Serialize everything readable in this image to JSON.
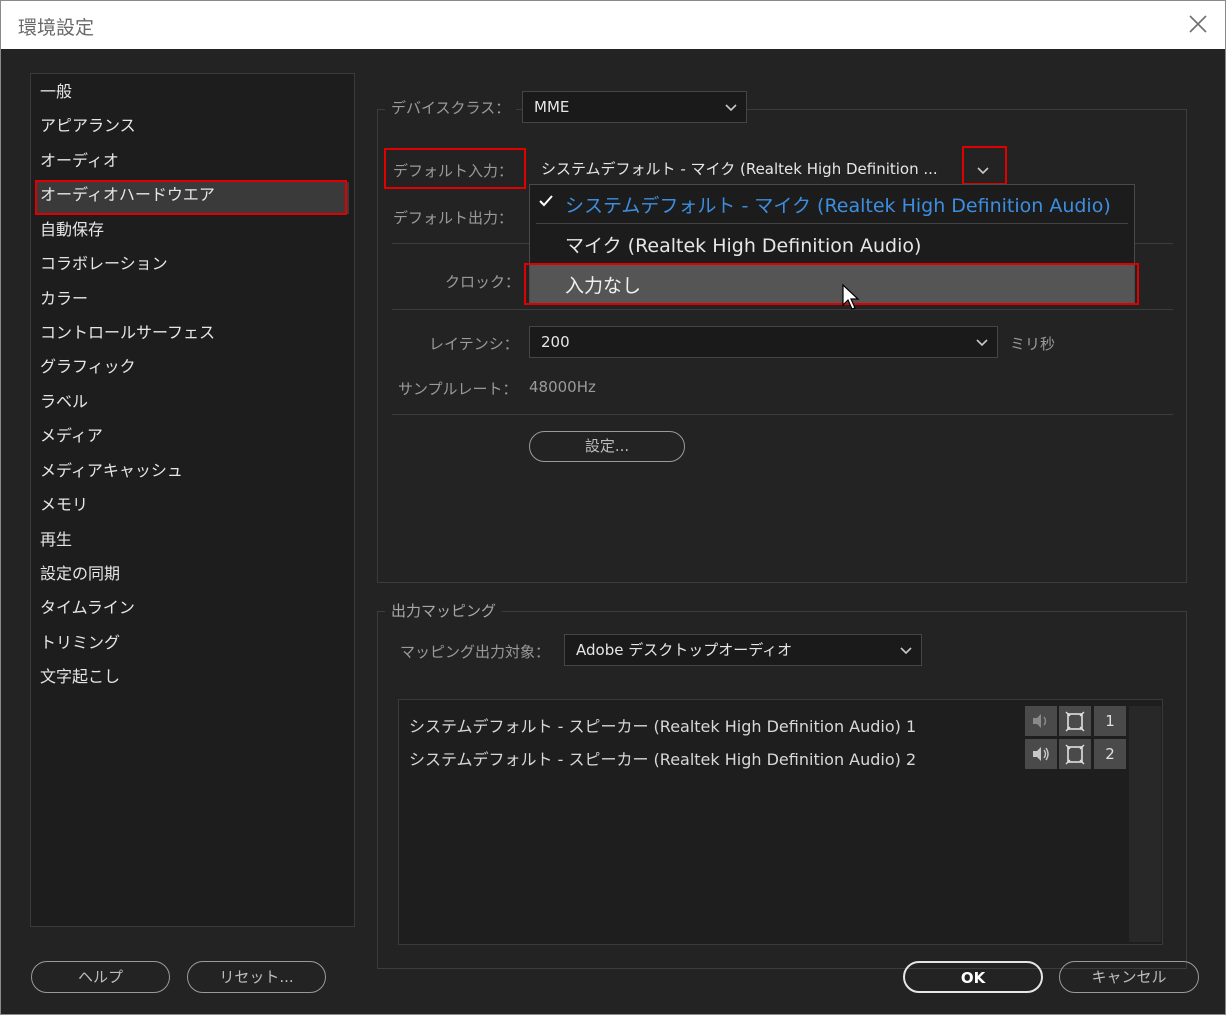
{
  "window": {
    "title": "環境設定"
  },
  "sidebar": {
    "items": [
      {
        "label": "一般"
      },
      {
        "label": "アピアランス"
      },
      {
        "label": "オーディオ"
      },
      {
        "label": "オーディオハードウエア"
      },
      {
        "label": "自動保存"
      },
      {
        "label": "コラボレーション"
      },
      {
        "label": "カラー"
      },
      {
        "label": "コントロールサーフェス"
      },
      {
        "label": "グラフィック"
      },
      {
        "label": "ラベル"
      },
      {
        "label": "メディア"
      },
      {
        "label": "メディアキャッシュ"
      },
      {
        "label": "メモリ"
      },
      {
        "label": "再生"
      },
      {
        "label": "設定の同期"
      },
      {
        "label": "タイムライン"
      },
      {
        "label": "トリミング"
      },
      {
        "label": "文字起こし"
      }
    ],
    "selected": "オーディオハードウエア"
  },
  "device": {
    "class_label": "デバイスクラス：",
    "class_value": "MME",
    "input_label": "デフォルト入力：",
    "input_value": "システムデフォルト - マイク (Realtek High Definition ...",
    "output_label": "デフォルト出力：",
    "clock_label": "クロック：",
    "latency_label": "レイテンシ：",
    "latency_value": "200",
    "latency_unit": "ミリ秒",
    "samplerate_label": "サンプルレート：",
    "samplerate_value": "48000Hz",
    "settings_button": "設定..."
  },
  "input_menu": {
    "options": [
      {
        "label": "システムデフォルト - マイク (Realtek High Definition Audio)",
        "checked": true
      },
      {
        "label": "マイク (Realtek High Definition Audio)",
        "checked": false
      },
      {
        "label": "入力なし",
        "checked": false,
        "hovered": true
      }
    ]
  },
  "output_mapping": {
    "group_label": "出力マッピング",
    "target_label": "マッピング出力対象：",
    "target_value": "Adobe デスクトップオーディオ",
    "rows": [
      {
        "label": "システムデフォルト - スピーカー (Realtek High Definition Audio) 1",
        "channel": "1"
      },
      {
        "label": "システムデフォルト - スピーカー (Realtek High Definition Audio) 2",
        "channel": "2"
      }
    ]
  },
  "footer": {
    "help": "ヘルプ",
    "reset": "リセット...",
    "ok": "OK",
    "cancel": "キャンセル"
  },
  "colors": {
    "background": "#232323",
    "highlight_red": "#e00000",
    "accent_blue": "#3d8ee0",
    "menu_hover": "#555555"
  }
}
